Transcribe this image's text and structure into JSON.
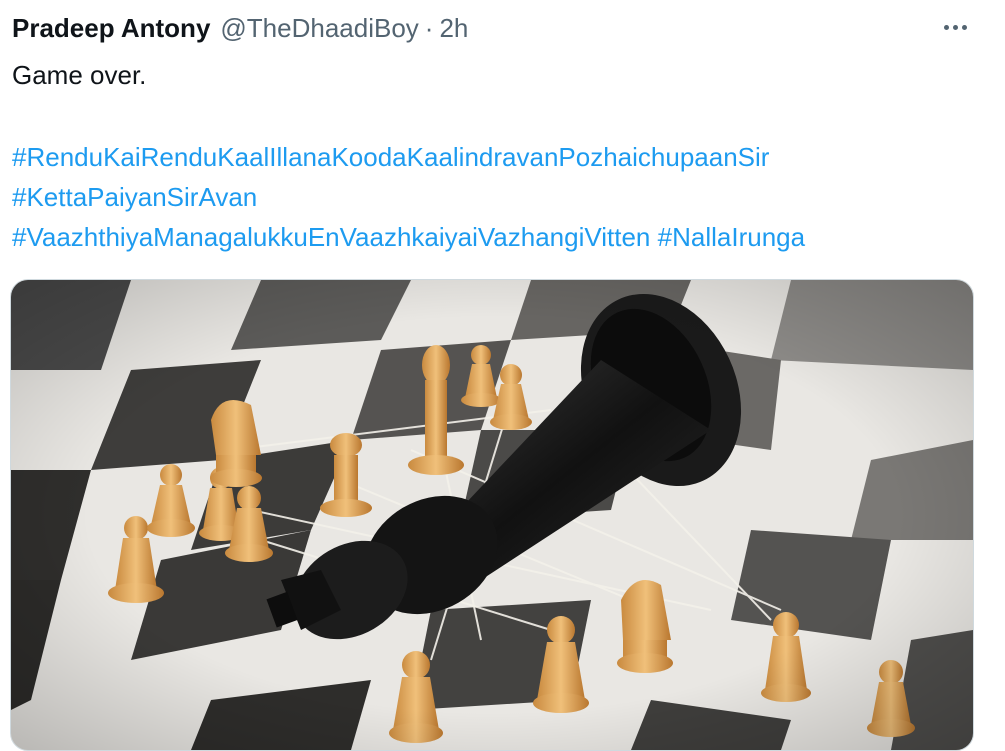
{
  "tweet": {
    "author_name": "Pradeep Antony",
    "author_handle": "@TheDhaadiBoy",
    "separator": "·",
    "timestamp": "2h",
    "body_text": "Game over.",
    "hashtags": [
      "#RenduKaiRenduKaalIllanaKoodaKaalindravanPozhaichupaanSir",
      "#KettaPaiyanSirAvan",
      "#VaazhthiyaManagalukkuEnVaazhkaiyaiVazhangiVitten",
      "#NallaIrunga"
    ],
    "more_icon": "more-horizontal-icon",
    "media": {
      "subject": "fallen-black-king-chess-image"
    },
    "colors": {
      "text": "#0f1419",
      "secondary": "#536471",
      "link": "#1d9bf0",
      "border": "#cfd9de"
    }
  }
}
